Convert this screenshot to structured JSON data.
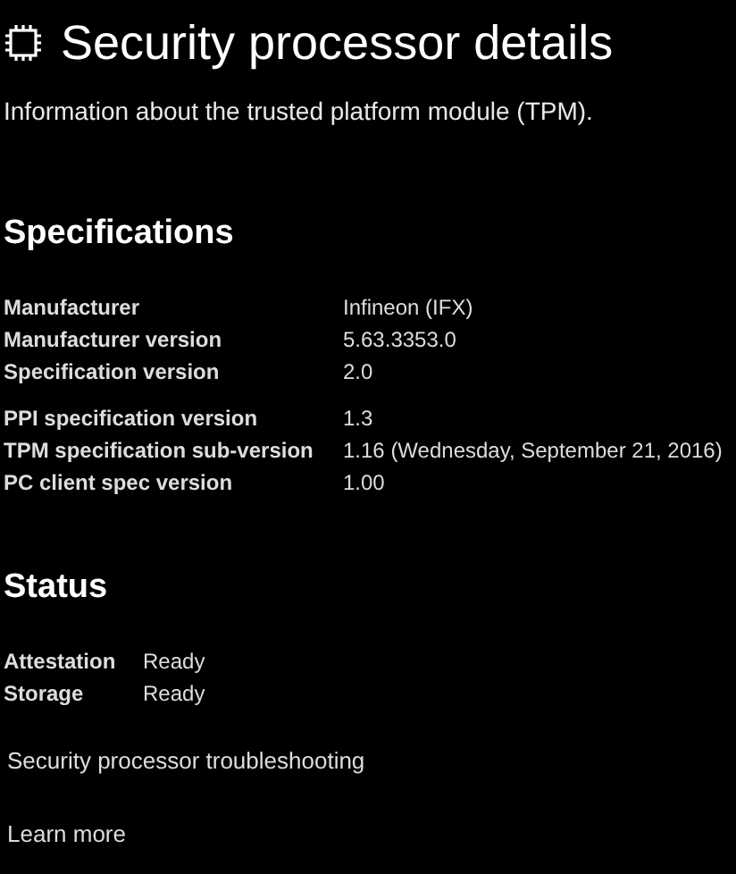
{
  "header": {
    "title": "Security processor details",
    "description": "Information about the trusted platform module (TPM)."
  },
  "specifications": {
    "title": "Specifications",
    "groups": [
      [
        {
          "label": "Manufacturer",
          "value": "Infineon (IFX)"
        },
        {
          "label": "Manufacturer version",
          "value": "5.63.3353.0"
        },
        {
          "label": "Specification version",
          "value": "2.0"
        }
      ],
      [
        {
          "label": "PPI specification version",
          "value": "1.3"
        },
        {
          "label": "TPM specification sub-version",
          "value": "1.16 (Wednesday, September 21, 2016)"
        },
        {
          "label": "PC client spec version",
          "value": "1.00"
        }
      ]
    ]
  },
  "status": {
    "title": "Status",
    "rows": [
      {
        "label": "Attestation",
        "value": "Ready"
      },
      {
        "label": "Storage",
        "value": "Ready"
      }
    ]
  },
  "links": [
    "Security processor troubleshooting",
    "Learn more"
  ]
}
